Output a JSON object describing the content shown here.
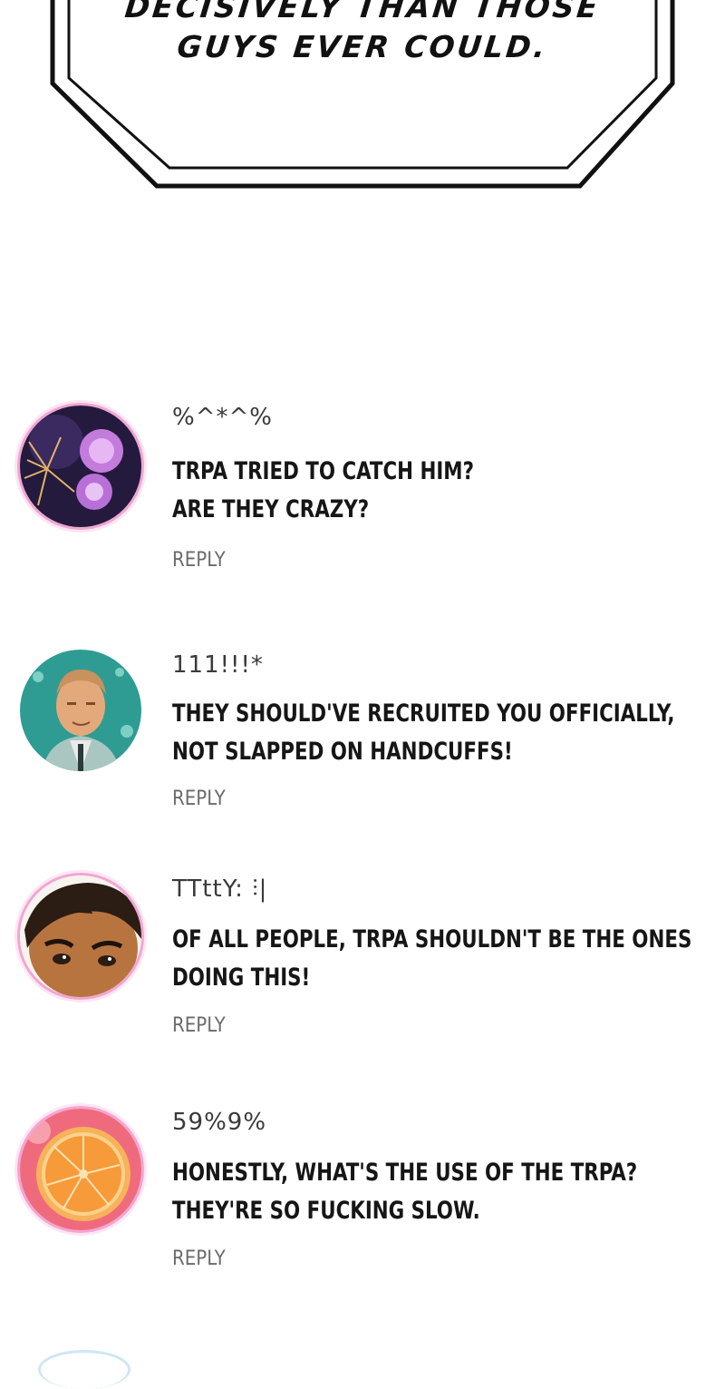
{
  "bubble": {
    "line1": "DECISIVELY THAN THOSE",
    "line2": "GUYS EVER COULD."
  },
  "comments": [
    {
      "username": "%^*^%",
      "line1": "TRPA TRIED TO CATCH HIM?",
      "line2": "ARE THEY CRAZY?",
      "reply_label": "REPLY",
      "avatar_icon": "fireworks-orbs-avatar"
    },
    {
      "username": "111!!!*",
      "line1": "THEY SHOULD'VE RECRUITED YOU OFFICIALLY,",
      "line2": "NOT SLAPPED ON HANDCUFFS!",
      "reply_label": "REPLY",
      "avatar_icon": "man-portrait-avatar"
    },
    {
      "username": "TTttY: ⫶|",
      "line1": "OF ALL PEOPLE, TRPA SHOULDN'T BE THE ONES",
      "line2": "DOING THIS!",
      "reply_label": "REPLY",
      "avatar_icon": "boy-face-avatar"
    },
    {
      "username": "59%9%",
      "line1": "HONESTLY, WHAT'S THE USE OF THE TRPA?",
      "line2": "THEY'RE SO FUCKING SLOW.",
      "reply_label": "REPLY",
      "avatar_icon": "orange-slice-avatar"
    }
  ]
}
